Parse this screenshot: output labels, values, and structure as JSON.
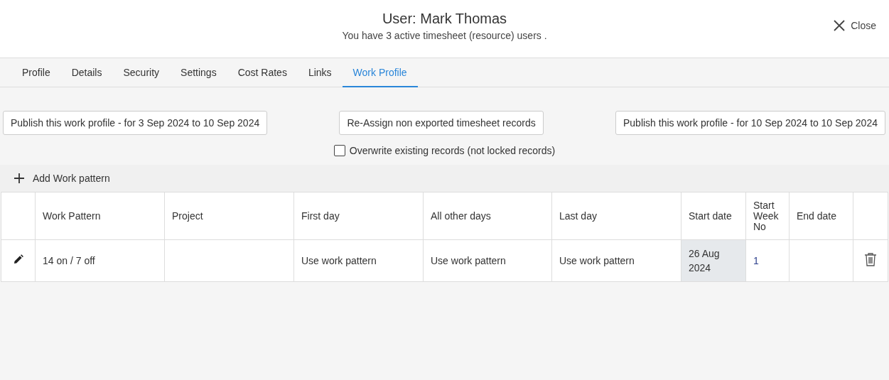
{
  "header": {
    "title": "User: Mark Thomas",
    "subtitle": "You have 3 active timesheet (resource) users .",
    "close_label": "Close"
  },
  "tabs": [
    {
      "label": "Profile",
      "selected": false
    },
    {
      "label": "Details",
      "selected": false
    },
    {
      "label": "Security",
      "selected": false
    },
    {
      "label": "Settings",
      "selected": false
    },
    {
      "label": "Cost Rates",
      "selected": false
    },
    {
      "label": "Links",
      "selected": false
    },
    {
      "label": "Work Profile",
      "selected": true
    }
  ],
  "actions": [
    "Publish this work profile - for 3 Sep 2024 to 10 Sep 2024",
    "Re-Assign non exported timesheet records",
    "Publish this work profile - for 10 Sep 2024 to 10 Sep 2024"
  ],
  "overwrite": {
    "label": "Overwrite existing records (not locked records)",
    "checked": false
  },
  "add_button": "Add Work pattern",
  "table": {
    "columns": [
      "Work Pattern",
      "Project",
      "First day",
      "All other days",
      "Last day",
      "Start date",
      "Start Week No",
      "End date"
    ],
    "rows": [
      {
        "work_pattern": "14 on / 7 off",
        "project": "",
        "first_day": "Use work pattern",
        "all_other_days": "Use work pattern",
        "last_day": "Use work pattern",
        "start_date": "26 Aug 2024",
        "start_date_highlighted": true,
        "start_week_no": "1",
        "end_date": ""
      }
    ]
  }
}
